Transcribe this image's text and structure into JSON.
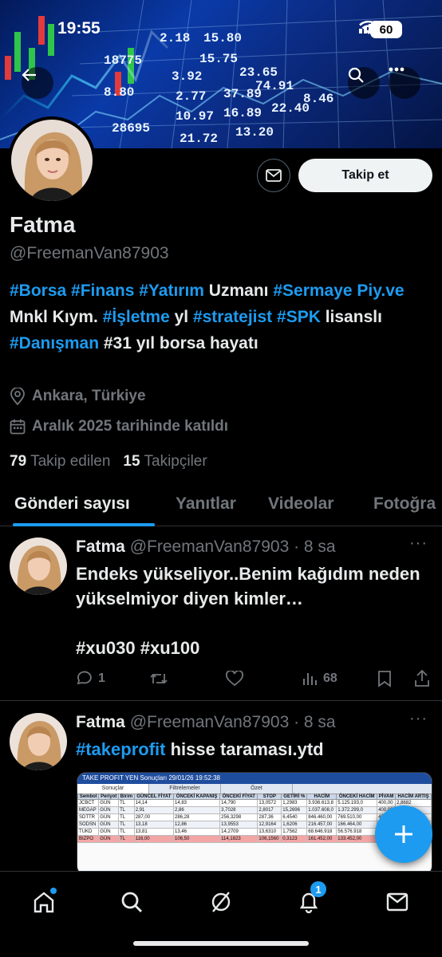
{
  "status": {
    "time": "19:55",
    "battery": "60"
  },
  "banner": {
    "numbers": [
      "2.18",
      "15.80",
      "18775",
      "15.75",
      "3.92",
      "23.65",
      "8.80",
      "2.77",
      "37.89",
      "74.91",
      "10.97",
      "16.89",
      "28695",
      "21.72",
      "13.20",
      "22.40",
      "8.46"
    ]
  },
  "profile": {
    "name": "Fatma",
    "handle": "@FreemanVan87903",
    "follow_label": "Takip et",
    "bio": [
      {
        "t": "#Borsa",
        "tag": true
      },
      {
        "t": " ",
        "tag": false
      },
      {
        "t": "#Finans",
        "tag": true
      },
      {
        "t": " ",
        "tag": false
      },
      {
        "t": "#Yatırım",
        "tag": true
      },
      {
        "t": " Uzmanı ",
        "tag": false
      },
      {
        "t": "#Sermaye Piy.ve",
        "tag": true
      },
      {
        "t": " Mnkl Kıym. ",
        "tag": false
      },
      {
        "t": "#İşletme",
        "tag": true
      },
      {
        "t": " yl ",
        "tag": false
      },
      {
        "t": "#stratejist",
        "tag": true
      },
      {
        "t": " ",
        "tag": false
      },
      {
        "t": "#SPK",
        "tag": true
      },
      {
        "t": " lisanslı ",
        "tag": false
      },
      {
        "t": "#Danışman",
        "tag": true
      },
      {
        "t": " #31 yıl borsa hayatı",
        "tag": false
      }
    ],
    "location": "Ankara, Türkiye",
    "joined": "Aralık 2025 tarihinde katıldı",
    "following_count": "79",
    "following_label": "Takip edilen",
    "followers_count": "15",
    "followers_label": "Takipçiler"
  },
  "tabs": [
    {
      "label": "Gönderi sayısı",
      "active": true
    },
    {
      "label": "Yanıtlar",
      "active": false
    },
    {
      "label": "Videolar",
      "active": false
    },
    {
      "label": "Fotoğra",
      "active": false
    }
  ],
  "posts": [
    {
      "name": "Fatma",
      "meta": "@FreemanVan87903 · 8 sa",
      "text": "Endeks yükseliyor..Benim kağıdım neden yükselmiyor diyen kimler…",
      "tags": "#xu030 #xu100",
      "replies": "1",
      "views": "68"
    },
    {
      "name": "Fatma",
      "meta": "@FreemanVan87903 · 8 sa",
      "text_tag": "#takeprofit",
      "text_rest": " hisse taraması.ytd",
      "image_title": "TAKE PROFIT YEN Sonuçları 29/01/26 19:52:38",
      "image_tabs": [
        "Sonuçlar",
        "Filtrelemeler",
        "Özet"
      ],
      "image_headers": [
        "Sembol",
        "Periyot",
        "Birim",
        "GÜNCEL FİYAT",
        "ÖNCEKİ KAPANIŞ",
        "ÖNCEKİ FİYAT",
        "STOP",
        "GETİRİ %",
        "HACİM",
        "ÖNCEKİ HACİM",
        "PİVAM",
        "HACİM ARTIŞ"
      ],
      "image_rows": [
        [
          "JCBCT",
          "GÜN",
          "TL",
          "14,14",
          "14,83",
          "14,790",
          "13,0572",
          "1,2983",
          "3.936.613,8",
          "5.125.193,0",
          "400,00",
          "2,8682"
        ],
        [
          "MEGAP",
          "GÜN",
          "TL",
          "2,91",
          "2,86",
          "3,7028",
          "2,8017",
          "15,2696",
          "1.037.608,0",
          "1.372.299,0",
          "400,00",
          "1,2308"
        ],
        [
          "SDTTR",
          "GÜN",
          "TL",
          "287,00",
          "286,28",
          "256,3298",
          "287,36",
          "6,4540",
          "846.460,00",
          "769.510,00",
          "400,00",
          "1,9076"
        ],
        [
          "SODSN",
          "GÜN",
          "TL",
          "13,18",
          "12,86",
          "13,9553",
          "12,9164",
          "1,6206",
          "216.457,00",
          "166.464,00",
          "400,00",
          "1,3003"
        ],
        [
          "TUKD",
          "GÜN",
          "TL",
          "13,81",
          "13,46",
          "14,2709",
          "13,6310",
          "1,7562",
          "68.646.918",
          "56.576.918",
          "400,00",
          "1,2219"
        ],
        [
          "BIZPO",
          "GÜN",
          "TL",
          "116,00",
          "106,50",
          "114,1823",
          "106,1560",
          "0,3123",
          "161.452,00",
          "133.452,00",
          "400,00",
          "1,4066"
        ]
      ]
    }
  ],
  "nav": [
    "home",
    "search",
    "grok",
    "notifications",
    "messages"
  ],
  "notifications_badge": "1"
}
